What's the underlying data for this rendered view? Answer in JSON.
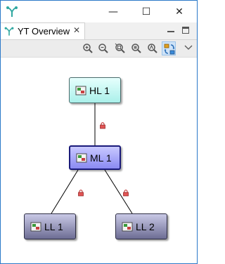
{
  "window": {
    "controls": {
      "minimize": "—",
      "maximize": "☐",
      "close": "✕"
    }
  },
  "view": {
    "tab_label": "YT Overview",
    "tab_close": "✕"
  },
  "toolbar": {
    "buttons": [
      "zoom-in",
      "zoom-out",
      "zoom-to-fit",
      "zoom-actual",
      "zoom-auto",
      "sync-layout"
    ],
    "active_button": "sync-layout"
  },
  "graph": {
    "nodes": [
      {
        "id": "hl1",
        "label": "HL 1",
        "level": "high"
      },
      {
        "id": "ml1",
        "label": "ML 1",
        "level": "mid",
        "selected": true
      },
      {
        "id": "ll1",
        "label": "LL 1",
        "level": "low"
      },
      {
        "id": "ll2",
        "label": "LL 2",
        "level": "low"
      }
    ],
    "edges": [
      {
        "from": "hl1",
        "to": "ml1",
        "icon": "lock-icon"
      },
      {
        "from": "ml1",
        "to": "ll1",
        "icon": "lock-icon"
      },
      {
        "from": "ml1",
        "to": "ll2",
        "icon": "lock-icon"
      }
    ]
  },
  "colors": {
    "high_node": "#aaf0ea",
    "mid_node": "#8a8af2",
    "low_node": "#6d6d94",
    "accent": "#2b79c9",
    "lock": "#d23a3a"
  }
}
